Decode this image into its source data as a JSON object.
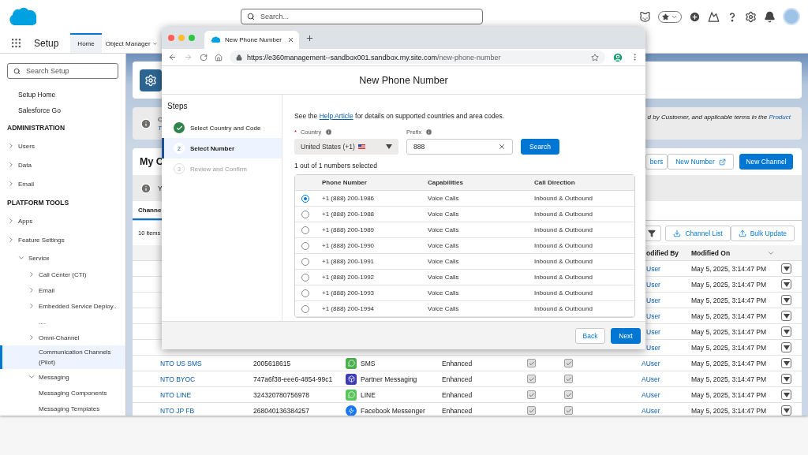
{
  "header": {
    "search": {
      "placeholder": "Search..."
    }
  },
  "nav": {
    "app_name": "Setup",
    "tabs": [
      {
        "label": "Home",
        "selected": true,
        "menu": false
      },
      {
        "label": "Object Manager",
        "selected": false,
        "menu": true
      }
    ]
  },
  "sidebar": {
    "search": {
      "placeholder": "Search Setup"
    },
    "links": [
      {
        "label": "Setup Home"
      },
      {
        "label": "Salesforce Go"
      }
    ],
    "sections": [
      {
        "title": "ADMINISTRATION",
        "items": [
          {
            "label": "Users",
            "expanded": false,
            "selected": false
          },
          {
            "label": "Data",
            "expanded": false,
            "selected": false
          },
          {
            "label": "Email",
            "expanded": false,
            "selected": false
          }
        ]
      },
      {
        "title": "PLATFORM TOOLS",
        "items": [
          {
            "label": "Apps",
            "expanded": false,
            "selected": false
          },
          {
            "label": "Feature Settings",
            "expanded": false,
            "selected": false,
            "children": [
              {
                "label": "Service",
                "expanded": true,
                "selected": false,
                "children": [
                  {
                    "label": "Call Center (CTI)",
                    "expanded": false,
                    "selected": false
                  },
                  {
                    "label": "Email",
                    "expanded": false,
                    "selected": false
                  },
                  {
                    "label": "Embedded Service Deploy..",
                    "expanded": false,
                    "selected": false
                  },
                  {
                    "label": "....",
                    "selected": false
                  },
                  {
                    "label": "Omni-Channel",
                    "expanded": false,
                    "selected": false
                  },
                  {
                    "label": "Communication Channels (Pilot)",
                    "selected": true
                  },
                  {
                    "label": "Messaging",
                    "expanded": true,
                    "selected": false,
                    "children": [
                      {
                        "label": "Messaging Components",
                        "selected": false
                      },
                      {
                        "label": "Messaging Templates",
                        "selected": false
                      }
                    ]
                  }
                ]
              }
            ]
          }
        ]
      }
    ]
  },
  "banner": {
    "left_lines": [
      "C",
      "T"
    ],
    "text": "d by Customer, and applicable terms in the ",
    "link": "Product"
  },
  "card": {
    "title": "My C",
    "actions": [
      {
        "label": "bers",
        "kind": "outline"
      },
      {
        "label": "New Number",
        "kind": "external"
      },
      {
        "label": "New Channel",
        "kind": "brand"
      }
    ],
    "notice": "Y",
    "tab": {
      "label": "Channe",
      "selected": true
    },
    "count": "10 items",
    "tools": [
      {
        "label": "Channel List",
        "kind": "download"
      },
      {
        "label": "Bulk Update",
        "kind": "upload"
      }
    ],
    "columns": {
      "modified_by": "odified By",
      "modified_on": "Modified On"
    },
    "rows": [
      {
        "modified_by": "User",
        "modified_on": "May 5, 2025, 3:14:47 PM"
      },
      {
        "modified_by": "User",
        "modified_on": "May 5, 2025, 3:14:47 PM"
      },
      {
        "modified_by": "User",
        "modified_on": "May 5, 2025, 3:14:47 PM"
      },
      {
        "modified_by": "User",
        "modified_on": "May 5, 2025, 3:14:47 PM"
      },
      {
        "modified_by": "User",
        "modified_on": "May 5, 2025, 3:14:47 PM"
      },
      {
        "modified_by": "User",
        "modified_on": "May 5, 2025, 3:14:47 PM"
      },
      {
        "name": "NTO US SMS",
        "id": "2005618615",
        "channel": {
          "label": "SMS",
          "kind": "sms"
        },
        "type": "Enhanced",
        "checks": [
          true,
          true
        ],
        "modified_by": "AUser",
        "modified_on": "May 5, 2025, 3:14:47 PM"
      },
      {
        "name": "NTO BYOC",
        "id": "747a6f38-eee6-4854-99c1",
        "channel": {
          "label": "Partner Messaging",
          "kind": "partner"
        },
        "type": "Enhanced",
        "checks": [
          true,
          true
        ],
        "modified_by": "AUser",
        "modified_on": "May 5, 2025, 3:14:47 PM"
      },
      {
        "name": "NTO LINE",
        "id": "324320780756978",
        "channel": {
          "label": "LINE",
          "kind": "line"
        },
        "type": "Enhanced",
        "checks": [
          true,
          true
        ],
        "modified_by": "AUser",
        "modified_on": "May 5, 2025, 3:14:47 PM"
      },
      {
        "name": "NTO JP FB",
        "id": "268040136384257",
        "channel": {
          "label": "Facebook Messenger",
          "kind": "messenger"
        },
        "type": "Enhanced",
        "checks": [
          true,
          true
        ],
        "modified_by": "AUser",
        "modified_on": "May 5, 2025, 3:14:47 PM"
      }
    ]
  },
  "browser": {
    "tab_title": "New Phone Number",
    "url_host": "https://e360management--sandbox001.sandbox.my.site.com",
    "url_path": "/new-phone-number",
    "page_title": "New Phone Number",
    "steps_title": "Steps",
    "steps": [
      {
        "label": "Select Country and Code",
        "kind": "complete",
        "selected": false
      },
      {
        "number": "2",
        "label": "Select Number",
        "kind": "current",
        "selected": true
      },
      {
        "number": "3",
        "label": "Review and Confirm",
        "kind": "upcoming",
        "selected": false
      }
    ],
    "intro_before": "See the ",
    "intro_link": "Help Article",
    "intro_after": " for details on supported countries and area codes.",
    "country": {
      "required_mark": "*",
      "label": "Country",
      "value": "United States (+1)"
    },
    "prefix": {
      "label": "Prefix",
      "value": "888"
    },
    "search_button": "Search",
    "summary": "1 out of 1 numbers selected",
    "columns": [
      "Phone Number",
      "Capabilities",
      "Call Direction"
    ],
    "rows": [
      {
        "number": "+1 (888) 200-1986",
        "capabilities": "Voice Calls",
        "direction": "Inbound & Outbound",
        "selected": true
      },
      {
        "number": "+1 (888) 200-1988",
        "capabilities": "Voice Calls",
        "direction": "Inbound & Outbound",
        "selected": false
      },
      {
        "number": "+1 (888) 200-1989",
        "capabilities": "Voice Calls",
        "direction": "Inbound & Outbound",
        "selected": false
      },
      {
        "number": "+1 (888) 200-1990",
        "capabilities": "Voice Calls",
        "direction": "Inbound & Outbound",
        "selected": false
      },
      {
        "number": "+1 (888) 200-1991",
        "capabilities": "Voice Calls",
        "direction": "Inbound & Outbound",
        "selected": false
      },
      {
        "number": "+1 (888) 200-1992",
        "capabilities": "Voice Calls",
        "direction": "Inbound & Outbound",
        "selected": false
      },
      {
        "number": "+1 (888) 200-1993",
        "capabilities": "Voice Calls",
        "direction": "Inbound & Outbound",
        "selected": false
      },
      {
        "number": "+1 (888) 200-1994",
        "capabilities": "Voice Calls",
        "direction": "Inbound & Outbound",
        "selected": false
      }
    ],
    "buttons": [
      {
        "label": "Back",
        "kind": "neutral"
      },
      {
        "label": "Next",
        "kind": "brand"
      }
    ]
  }
}
